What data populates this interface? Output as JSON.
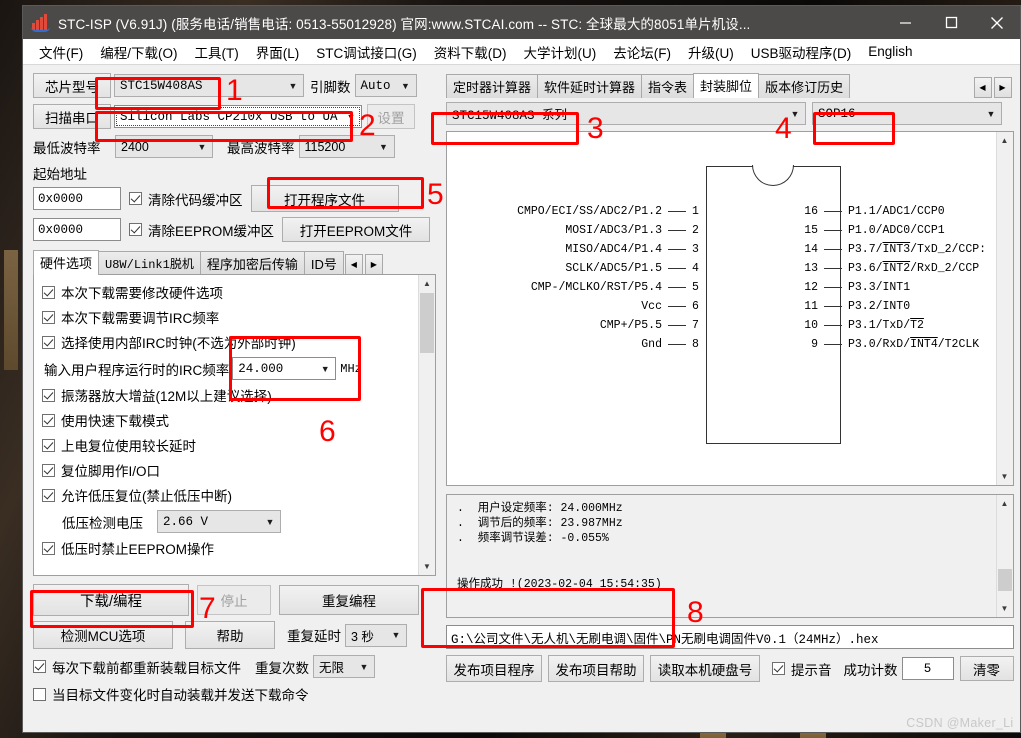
{
  "window": {
    "title": "STC-ISP (V6.91J) (服务电话/销售电话: 0513-55012928) 官网:www.STCAI.com  -- STC: 全球最大的8051单片机设...",
    "minimize_label": "minimize",
    "maximize_label": "maximize",
    "close_label": "close"
  },
  "menubar": [
    {
      "text": "文件(F)",
      "key": "F"
    },
    {
      "text": "编程/下载(O)",
      "key": "O"
    },
    {
      "text": "工具(T)",
      "key": "T"
    },
    {
      "text": "界面(L)",
      "key": "L"
    },
    {
      "text": "STC调试接口(G)",
      "key": "G"
    },
    {
      "text": "资料下载(D)",
      "key": "D"
    },
    {
      "text": "大学计划(U)",
      "key": "U"
    },
    {
      "text": "去论坛(F)",
      "key": "F"
    },
    {
      "text": "升级(U)",
      "key": "U"
    },
    {
      "text": "USB驱动程序(D)",
      "key": "D"
    },
    {
      "text": "English",
      "key": "E"
    }
  ],
  "left": {
    "chip_model_label": "芯片型号",
    "chip_model_value": "STC15W408AS",
    "pin_count_label": "引脚数",
    "pin_count_value": "Auto",
    "scan_port_label": "扫描串口",
    "scan_port_value": "Silicon Labs CP210x USB to UA",
    "settings_button": "设置",
    "min_baud_label": "最低波特率",
    "min_baud_value": "2400",
    "max_baud_label": "最高波特率",
    "max_baud_value": "115200",
    "start_address_label": "起始地址",
    "code_addr_value": "0x0000",
    "eeprom_addr_value": "0x0000",
    "clear_code_buffer": "清除代码缓冲区",
    "clear_eeprom_buffer": "清除EEPROM缓冲区",
    "open_program_file": "打开程序文件",
    "open_eeprom_file": "打开EEPROM文件",
    "tabs": [
      {
        "label": "硬件选项",
        "active": true
      },
      {
        "label": "U8W/Link1脱机",
        "active": false
      },
      {
        "label": "程序加密后传输",
        "active": false
      },
      {
        "label": "ID号",
        "active": false
      }
    ],
    "options": [
      {
        "label": "本次下载需要修改硬件选项",
        "checked": true
      },
      {
        "label": "本次下载需要调节IRC频率",
        "checked": true
      },
      {
        "label": "选择使用内部IRC时钟(不选为外部时钟)",
        "checked": true
      }
    ],
    "irc_row_label": "输入用户程序运行时的IRC频率",
    "irc_value": "24.000",
    "irc_unit": "MHz",
    "options2": [
      {
        "label": "振荡器放大增益(12M以上建议选择)",
        "checked": true
      },
      {
        "label": "使用快速下载模式",
        "checked": true
      },
      {
        "label": "上电复位使用较长延时",
        "checked": true
      },
      {
        "label": "复位脚用作I/O口",
        "checked": true
      },
      {
        "label": "允许低压复位(禁止低压中断)",
        "checked": true
      }
    ],
    "lvd_label": "低压检测电压",
    "lvd_value": "2.66 V",
    "option_last": {
      "label": "低压时禁止EEPROM操作",
      "checked": true
    },
    "download_button": "下载/编程",
    "stop_button": "停止",
    "repeat_program_button": "重复编程",
    "detect_mcu_button": "检测MCU选项",
    "help_button": "帮助",
    "repeat_delay_label": "重复延时",
    "repeat_delay_value": "3 秒",
    "repeat_count_label": "重复次数",
    "repeat_count_value": "无限",
    "reload_checkbox": {
      "label": "每次下载前都重新装载目标文件",
      "checked": true
    },
    "autoload_checkbox": {
      "label": "当目标文件变化时自动装载并发送下载命令",
      "checked": false
    }
  },
  "right": {
    "tabs": [
      {
        "label": "定时器计算器",
        "active": false
      },
      {
        "label": "软件延时计算器",
        "active": false
      },
      {
        "label": "指令表",
        "active": false
      },
      {
        "label": "封装脚位",
        "active": true
      },
      {
        "label": "版本修订历史",
        "active": false
      }
    ],
    "series_value": "STC15W408AS 系列",
    "package_value": "SOP16",
    "pins_left": [
      {
        "num": "1",
        "label": "CMPO/ECI/SS/ADC2/P1.2"
      },
      {
        "num": "2",
        "label": "MOSI/ADC3/P1.3"
      },
      {
        "num": "3",
        "label": "MISO/ADC4/P1.4"
      },
      {
        "num": "4",
        "label": "SCLK/ADC5/P1.5"
      },
      {
        "num": "5",
        "label": "CMP-/MCLKO/RST/P5.4"
      },
      {
        "num": "6",
        "label": "Vcc"
      },
      {
        "num": "7",
        "label": "CMP+/P5.5"
      },
      {
        "num": "8",
        "label": "Gnd"
      }
    ],
    "pins_right": [
      {
        "num": "16",
        "label": "P1.1/ADC1/CCP0"
      },
      {
        "num": "15",
        "label": "P1.0/ADC0/CCP1"
      },
      {
        "num": "14",
        "label": "P3.7/INT3/TxD_2/CCP:"
      },
      {
        "num": "13",
        "label": "P3.6/INT2/RxD_2/CCP"
      },
      {
        "num": "12",
        "label": "P3.3/INT1"
      },
      {
        "num": "11",
        "label": "P3.2/INT0"
      },
      {
        "num": "10",
        "label": "P3.1/TxD/T2"
      },
      {
        "num": "9",
        "label": "P3.0/RxD/INT4/T2CLK"
      }
    ],
    "log_lines": [
      ".  用户设定频率: 24.000MHz",
      ".  调节后的频率: 23.987MHz",
      ".  频率调节误差: -0.055%",
      "",
      "操作成功 !(2023-02-04 15:54:35)"
    ],
    "file_path": "G:\\公司文件\\无人机\\无刷电调\\固件\\PN无刷电调固件V0.1（24MHz）.hex",
    "publish_program_button": "发布项目程序",
    "publish_help_button": "发布项目帮助",
    "read_disk_id_button": "读取本机硬盘号",
    "beep_checkbox": {
      "label": "提示音",
      "checked": true
    },
    "success_count_label": "成功计数",
    "success_count_value": "5",
    "clear_count_button": "清零"
  },
  "annotations": [
    {
      "number": "1"
    },
    {
      "number": "2"
    },
    {
      "number": "3"
    },
    {
      "number": "4"
    },
    {
      "number": "5"
    },
    {
      "number": "6"
    },
    {
      "number": "7"
    },
    {
      "number": "8"
    }
  ],
  "watermark": "CSDN @Maker_Li",
  "colors": {
    "annotation": "#ff0000",
    "titlebar": "#4c4a48",
    "window_bg": "#f0f0f0"
  }
}
